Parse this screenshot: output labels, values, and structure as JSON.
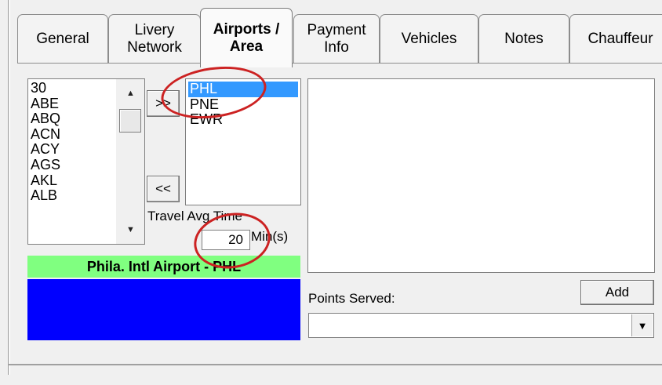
{
  "tabs": [
    {
      "label": "General",
      "active": false
    },
    {
      "label": "Livery\nNetwork",
      "active": false
    },
    {
      "label": "Airports /\nArea",
      "active": true
    },
    {
      "label": "Payment\nInfo",
      "active": false
    },
    {
      "label": "Vehicles",
      "active": false
    },
    {
      "label": "Notes",
      "active": false
    },
    {
      "label": "Chauffeur",
      "active": false
    }
  ],
  "airport_list": {
    "items": [
      "30",
      "ABE",
      "ABQ",
      "ACN",
      "ACY",
      "AGS",
      "AKL",
      "ALB"
    ]
  },
  "buttons": {
    "add_selected": ">>",
    "remove_selected": "<<",
    "add": "Add"
  },
  "selected_list": {
    "items": [
      "PHL",
      "PNE",
      "EWR"
    ],
    "selected_index": 0
  },
  "travel": {
    "label": "Travel Avg Time",
    "value": "20",
    "unit": "Min(s)"
  },
  "airport_name": "Phila. Intl Airport - PHL",
  "points_served": {
    "label": "Points Served:",
    "value": ""
  },
  "colors": {
    "selection": "#3399ff",
    "name_bar": "#80ff80",
    "blue_panel": "#0000ff",
    "annotation": "#cc2222"
  },
  "icons": {
    "scroll_up": "triangle-up",
    "scroll_down": "triangle-down",
    "dropdown": "triangle-down"
  }
}
